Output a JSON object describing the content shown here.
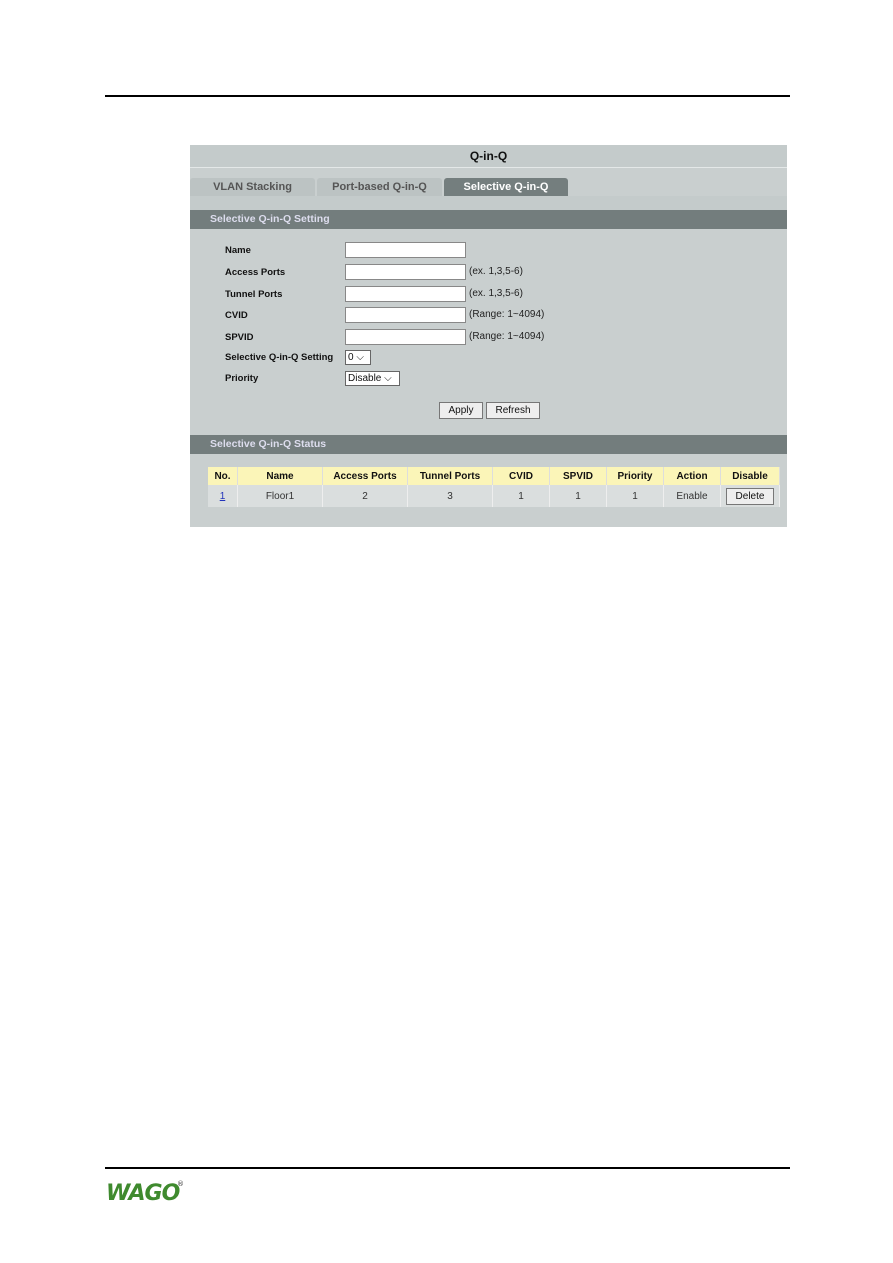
{
  "panel": {
    "title": "Q-in-Q",
    "tabs": [
      {
        "label": "VLAN Stacking"
      },
      {
        "label": "Port-based Q-in-Q"
      },
      {
        "label": "Selective Q-in-Q",
        "active": true
      }
    ],
    "setting": {
      "header": "Selective Q-in-Q Setting",
      "name_label": "Name",
      "name_value": "",
      "access_label": "Access Ports",
      "access_value": "",
      "access_hint": "(ex. 1,3,5-6)",
      "tunnel_label": "Tunnel Ports",
      "tunnel_value": "",
      "tunnel_hint": "(ex. 1,3,5-6)",
      "cvid_label": "CVID",
      "cvid_value": "",
      "cvid_hint": "(Range: 1~4094)",
      "spvid_label": "SPVID",
      "spvid_value": "",
      "spvid_hint": "(Range: 1~4094)",
      "sel_label": "Selective Q-in-Q Setting",
      "sel_value": "0",
      "priority_label": "Priority",
      "priority_value": "Disable",
      "apply": "Apply",
      "refresh": "Refresh"
    },
    "status": {
      "header": "Selective Q-in-Q Status",
      "columns": [
        "No.",
        "Name",
        "Access Ports",
        "Tunnel Ports",
        "CVID",
        "SPVID",
        "Priority",
        "Action",
        "Disable"
      ],
      "rows": [
        {
          "no": "1",
          "name": "Floor1",
          "access": "2",
          "tunnel": "3",
          "cvid": "1",
          "spvid": "1",
          "priority": "1",
          "action": "Enable",
          "delete": "Delete"
        }
      ]
    }
  },
  "footer": {
    "logo": "WAGO"
  },
  "colors": {
    "logo": "#3f8a2e",
    "header": "#737d7d",
    "table_header": "#fbf5b8"
  }
}
